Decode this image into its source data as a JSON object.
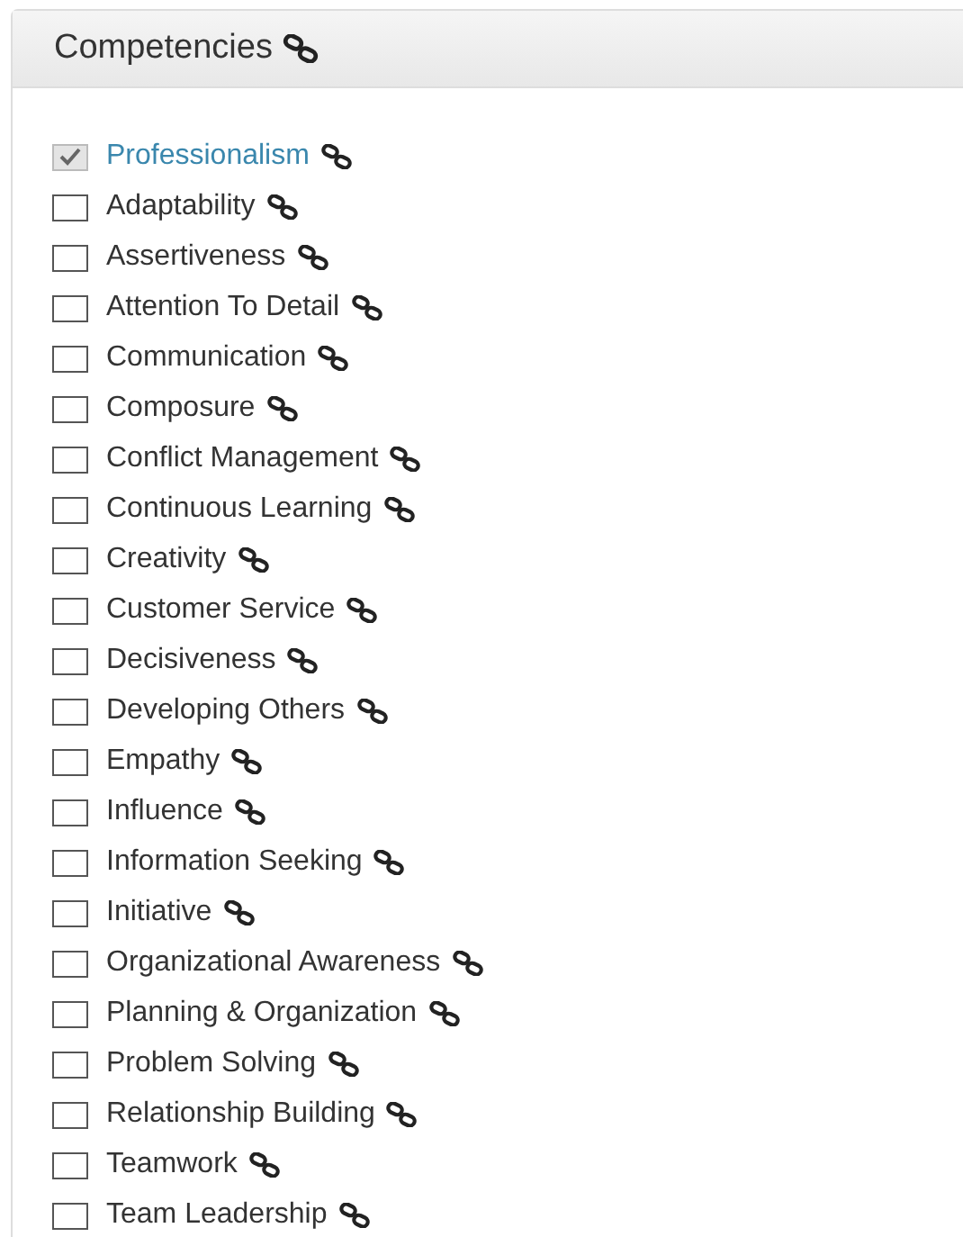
{
  "panel": {
    "title": "Competencies"
  },
  "items": [
    {
      "label": "Professionalism",
      "checked": true
    },
    {
      "label": "Adaptability",
      "checked": false
    },
    {
      "label": "Assertiveness",
      "checked": false
    },
    {
      "label": "Attention To Detail",
      "checked": false
    },
    {
      "label": "Communication",
      "checked": false
    },
    {
      "label": "Composure",
      "checked": false
    },
    {
      "label": "Conflict Management",
      "checked": false
    },
    {
      "label": "Continuous Learning",
      "checked": false
    },
    {
      "label": "Creativity",
      "checked": false
    },
    {
      "label": "Customer Service",
      "checked": false
    },
    {
      "label": "Decisiveness",
      "checked": false
    },
    {
      "label": "Developing Others",
      "checked": false
    },
    {
      "label": "Empathy",
      "checked": false
    },
    {
      "label": "Influence",
      "checked": false
    },
    {
      "label": "Information Seeking",
      "checked": false
    },
    {
      "label": "Initiative",
      "checked": false
    },
    {
      "label": "Organizational Awareness",
      "checked": false
    },
    {
      "label": "Planning & Organization",
      "checked": false
    },
    {
      "label": "Problem Solving",
      "checked": false
    },
    {
      "label": "Relationship Building",
      "checked": false
    },
    {
      "label": "Teamwork",
      "checked": false
    },
    {
      "label": "Team Leadership",
      "checked": false
    }
  ]
}
